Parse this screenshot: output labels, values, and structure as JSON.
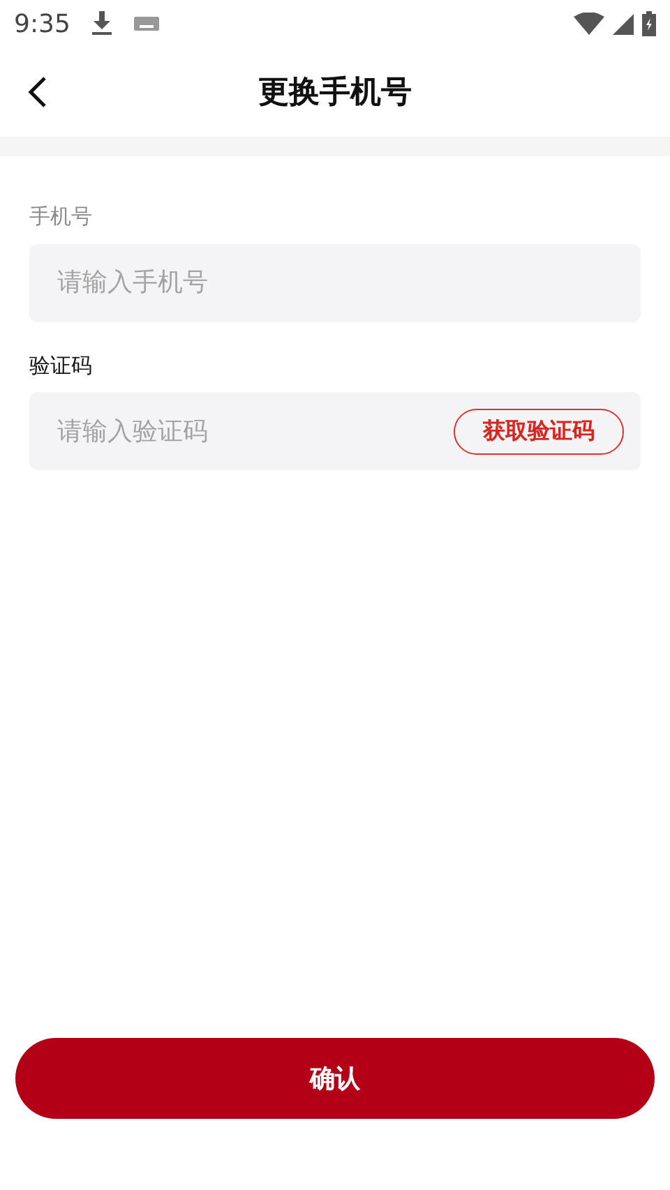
{
  "status_bar": {
    "time": "9:35"
  },
  "header": {
    "title": "更换手机号"
  },
  "fields": [
    {
      "kind": "phone",
      "label": "手机号",
      "placeholder": "请输入手机号"
    },
    {
      "kind": "code",
      "label": "验证码",
      "placeholder": "请输入验证码",
      "action": "获取验证码"
    }
  ],
  "confirm_button": "确认"
}
